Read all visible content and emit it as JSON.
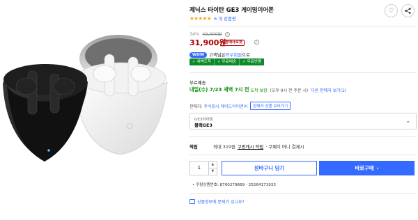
{
  "product": {
    "title": "제닉스 타이탄 GE3 게이밍이어폰",
    "rating_stars": "★★★★★",
    "review_count": "6 개 상품평"
  },
  "pricing": {
    "discount_rate": "34%",
    "original_price": "49,000원",
    "info_mark": "i",
    "sale_price": "31,900원",
    "rocket_badge": "판매자로켓",
    "wow_badge": "WOW",
    "wow_text_prefix": "고객님은",
    "wow_text_highlight": "와우회원",
    "wow_text_suffix": "으로"
  },
  "benefits": [
    "✓ 새벽도착",
    "✓ 무료배송",
    "✓ 무료반품"
  ],
  "shipping": {
    "label": "무료배송",
    "arrival_date": "내일(수) 7/23 새벽 7시 전",
    "guarantee": "도착 보장",
    "cutoff": "(오후 9시 전 주문 시)",
    "other_sellers": "다른 판매자 보기(2)"
  },
  "seller": {
    "label": "판매자:",
    "name": "주식회사 에이드이이엔씨",
    "products_button": "판매자 상품 보러가기"
  },
  "option": {
    "category": "GE3이어폰",
    "value": "블랙GE3",
    "chevron": "⌄"
  },
  "points": {
    "label": "적립",
    "text": "최대 319원",
    "link": "쿠팡캐시 적립",
    "suffix": "· 쿠페이 머니 결제시"
  },
  "purchase": {
    "quantity": "1",
    "up": "▲",
    "down": "▼",
    "cart_label": "장바구니 담기",
    "buy_label": "바로구매",
    "buy_arrow": "›"
  },
  "product_number": "• 쿠팡상품번호: 8700279869 - 25264171933",
  "inquiry": "상품정보에 문제가 있나요?",
  "icons": {
    "heart": "♡",
    "share": "<"
  },
  "colors": {
    "accent": "#346aff",
    "price": "#ae0000",
    "benefit_green": "#0d8a28",
    "arrival_green": "#008c00",
    "star": "#f5a623"
  }
}
